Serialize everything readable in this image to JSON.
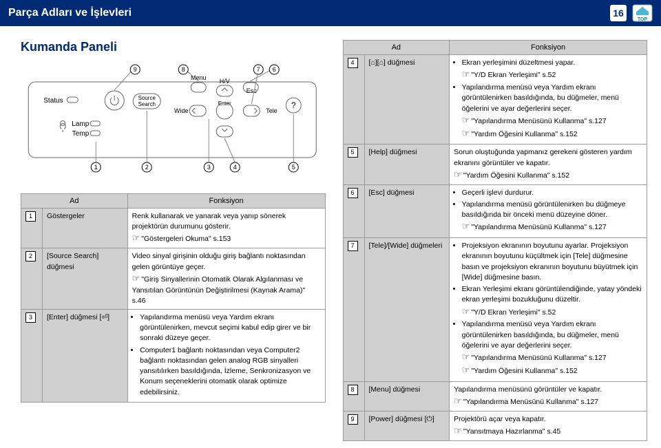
{
  "header": {
    "title": "Parça Adları ve İşlevleri",
    "page": "16",
    "top": "TOP"
  },
  "heading": "Kumanda Paneli",
  "diagram": {
    "callouts": [
      "1",
      "2",
      "3",
      "4",
      "5",
      "6",
      "7",
      "8",
      "9"
    ],
    "labels": {
      "status": "Status",
      "lamp": "Lamp",
      "temp": "Temp",
      "source": "Source\nSearch",
      "menu": "Menu",
      "wide": "Wide",
      "enter": "Enter",
      "hv": "H/V",
      "esc": "Esc",
      "tele": "Tele"
    }
  },
  "thead": {
    "name": "Ad",
    "func": "Fonksiyon"
  },
  "leftRows": [
    {
      "n": "1",
      "name": "Göstergeler",
      "func": {
        "t1": "Renk kullanarak ve yanarak veya yanıp sönerek projektörün durumunu gösterir.",
        "l1": "\"Göstergeleri Okuma\" s.153"
      }
    },
    {
      "n": "2",
      "name": "[Source Search] düğmesi",
      "func": {
        "t1": "Video sinyal girişinin olduğu giriş bağlantı noktasından gelen görüntüye geçer.",
        "l1": "\"Giriş Sinyallerinin Otomatik Olarak Algılanması ve Yansıtılan Görüntünün Değiştirilmesi (Kaynak Arama)\" s.46"
      }
    },
    {
      "n": "3",
      "name": "[Enter] düğmesi [⏎]",
      "func": {
        "b1": "Yapılandırma menüsü veya Yardım ekranı görüntülenirken, mevcut seçimi kabul edip girer ve bir sonraki düzeye geçer.",
        "b2": "Computer1 bağlantı noktasından veya Computer2 bağlantı noktasından gelen analog RGB sinyalleri yansıtılırken basıldığında, İzleme, Senkronizasyon ve Konum seçeneklerini otomatik olarak optimize edebilirsiniz."
      }
    }
  ],
  "rightRows": [
    {
      "n": "4",
      "name": "[⌂][⌂] düğmesi",
      "func": {
        "b1": "Ekran yerleşimini düzeltmesi yapar.",
        "l1": "\"Y/D Ekran Yerleşimi\" s.52",
        "b2": "Yapılandırma menüsü veya Yardım ekranı görüntülenirken basıldığında, bu düğmeler, menü öğelerini ve ayar değerlerini seçer.",
        "l2": "\"Yapılandırma Menüsünü Kullanma\" s.127",
        "l3": "\"Yardım Öğesini Kullanma\" s.152"
      }
    },
    {
      "n": "5",
      "name": "[Help] düğmesi",
      "func": {
        "t1": "Sorun oluştuğunda yapmanız gerekeni gösteren yardım ekranını görüntüler ve kapatır.",
        "l1": "\"Yardım Öğesini Kullanma\" s.152"
      }
    },
    {
      "n": "6",
      "name": "[Esc] düğmesi",
      "func": {
        "b1": "Geçerli işlevi durdurur.",
        "b2": "Yapılandırma menüsü görüntülenirken bu düğmeye basıldığında bir önceki menü düzeyine döner.",
        "l1": "\"Yapılandırma Menüsünü Kullanma\" s.127"
      }
    },
    {
      "n": "7",
      "name": "[Tele]/[Wide] düğmeleri",
      "func": {
        "b1": "Projeksiyon ekranının boyutunu ayarlar. Projeksiyon ekranının boyutunu küçültmek için [Tele] düğmesine basın ve projeksiyon ekranının boyutunu büyütmek için [Wide] düğmesine basın.",
        "b2": "Ekran Yerleşimi ekranı görüntülendiğinde, yatay yöndeki ekran yerleşimi bozukluğunu düzeltir.",
        "l1": "\"Y/D Ekran Yerleşimi\" s.52",
        "b3": "Yapılandırma menüsü veya Yardım ekranı görüntülenirken basıldığında, bu düğmeler, menü öğelerini ve ayar değerlerini seçer.",
        "l2": "\"Yapılandırma Menüsünü Kullanma\" s.127",
        "l3": "\"Yardım Öğesini Kullanma\" s.152"
      }
    },
    {
      "n": "8",
      "name": "[Menu] düğmesi",
      "func": {
        "t1": "Yapılandırma menüsünü görüntüler ve kapatır.",
        "l1": "\"Yapılandırma Menüsünü Kullanma\" s.127"
      }
    },
    {
      "n": "9",
      "name": "[Power] düğmesi [⏻]",
      "func": {
        "t1": "Projektörü açar veya kapatır.",
        "l1": "\"Yansıtmaya Hazırlanma\" s.45"
      }
    }
  ]
}
